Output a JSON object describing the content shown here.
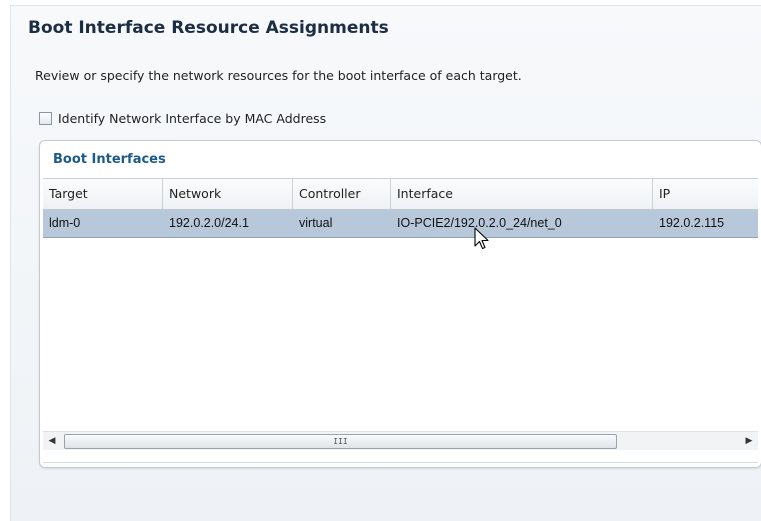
{
  "page": {
    "title": "Boot Interface Resource Assignments",
    "description": "Review or specify the network resources for the boot interface of each target."
  },
  "options": {
    "identify_by_mac_label": "Identify Network Interface by MAC Address",
    "identify_by_mac_checked": false
  },
  "boot_interfaces": {
    "title": "Boot Interfaces",
    "columns": [
      "Target",
      "Network",
      "Controller",
      "Interface",
      "IP"
    ],
    "rows": [
      {
        "target": "ldm-0",
        "network": "192.0.2.0/24.1",
        "controller": "virtual",
        "interface": "IO-PCIE2/192.0.2.0_24/net_0",
        "ip": "192.0.2.115",
        "selected": true
      }
    ]
  },
  "scrollbar": {
    "left_arrow": "◀",
    "right_arrow": "▶",
    "grip": "III"
  },
  "colors": {
    "selected_row": "#b8c8db",
    "title": "#1c2d44",
    "card_title": "#1d5a8c"
  },
  "icons": {
    "checkbox": "checkbox-icon",
    "cursor": "mouse-pointer-icon",
    "scroll_left": "scroll-left-arrow-icon",
    "scroll_right": "scroll-right-arrow-icon"
  }
}
